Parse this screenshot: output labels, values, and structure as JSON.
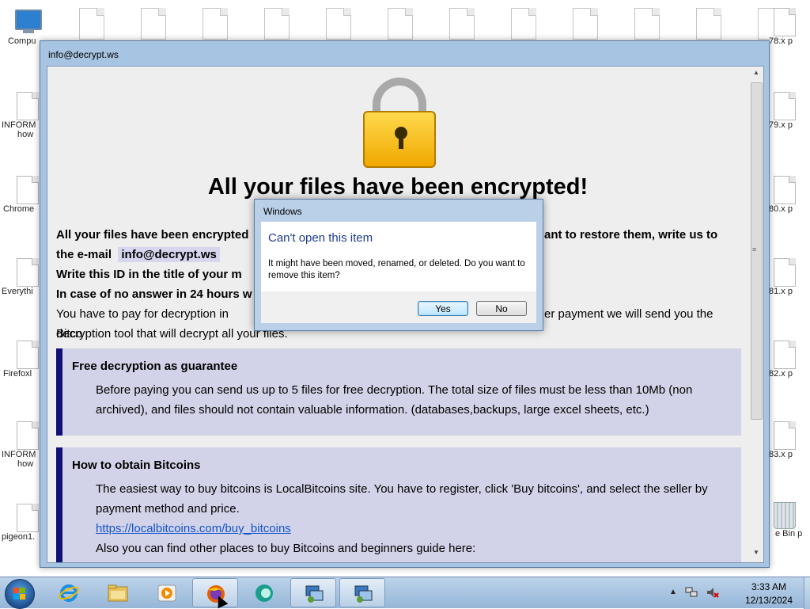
{
  "desktop": {
    "left_icons": [
      {
        "label": "Compu",
        "icon": "computer-icon"
      },
      {
        "label": "INFORM",
        "label2": "how",
        "icon": "document-icon"
      },
      {
        "label": "Chrome",
        "icon": "document-icon"
      },
      {
        "label": "Everythi",
        "icon": "document-icon"
      },
      {
        "label": "Firefoxl",
        "icon": "document-icon"
      },
      {
        "label": "INFORM",
        "label2": "how",
        "icon": "document-icon"
      },
      {
        "label": "pigeon1.",
        "icon": "document-icon"
      }
    ],
    "right_icons": [
      {
        "label": "78.x",
        "label2": "p",
        "icon": "document-icon"
      },
      {
        "label": "79.x",
        "label2": "p",
        "icon": "document-icon"
      },
      {
        "label": "80.x",
        "label2": "p",
        "icon": "document-icon"
      },
      {
        "label": "81.x",
        "label2": "p",
        "icon": "document-icon"
      },
      {
        "label": "82.x",
        "label2": "p",
        "icon": "document-icon"
      },
      {
        "label": "83.x",
        "label2": "p",
        "icon": "document-icon"
      },
      {
        "label": "e Bin",
        "label2": "p",
        "icon": "recycle-bin-icon"
      }
    ]
  },
  "main_window": {
    "title": "info@decrypt.ws",
    "headline": "All your files have been encrypted!",
    "line1_start": "All your files have been encrypted",
    "line1_end": "ant to restore them, write us to",
    "line2_prefix": "the e-mail",
    "email": "info@decrypt.ws",
    "line3": "Write this ID in the title of your m",
    "line4": "In case of no answer in 24 hours w",
    "line5_start": "You have to pay for decryption in Bitco",
    "line5_end": "er payment we will send you the",
    "line6": "decryption tool that will decrypt all your files.",
    "panel1": {
      "title": "Free decryption as guarantee",
      "body": "Before paying you can send us up to 5 files for free decryption. The total size of files must be less than 10Mb (non archived), and files should not contain valuable information. (databases,backups, large excel sheets, etc.)"
    },
    "panel2": {
      "title": "How to obtain Bitcoins",
      "body": "The easiest way to buy bitcoins is LocalBitcoins site. You have to register, click 'Buy bitcoins', and select the seller by payment method and price.",
      "link": "https://localbitcoins.com/buy_bitcoins",
      "body2": "Also you can find other places to buy Bitcoins and beginners guide here:"
    }
  },
  "dialog": {
    "title": "Windows",
    "heading": "Can't open this item",
    "message": "It might have been moved, renamed, or deleted. Do you want to remove this item?",
    "yes_label": "Yes",
    "no_label": "No"
  },
  "taskbar": {
    "buttons": [
      {
        "name": "internet-explorer",
        "icon": "internet-explorer-icon"
      },
      {
        "name": "file-explorer",
        "icon": "folder-icon"
      },
      {
        "name": "media-player",
        "icon": "media-player-icon"
      },
      {
        "name": "firefox",
        "icon": "firefox-icon",
        "active": true
      },
      {
        "name": "app-green",
        "icon": "green-app-icon"
      },
      {
        "name": "app-1",
        "icon": "program-icon",
        "active": true
      },
      {
        "name": "app-2",
        "icon": "program-icon",
        "active": true
      }
    ],
    "time": "3:33 AM",
    "date": "12/13/2024"
  },
  "colors": {
    "window_frame": "#a7c4e2",
    "panel_bg": "#d2d2e8",
    "panel_bar": "#101078",
    "dialog_heading": "#1e3d8f",
    "link": "#1155cc"
  }
}
